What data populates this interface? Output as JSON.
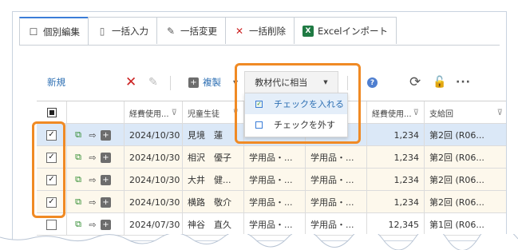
{
  "tabs": [
    {
      "label": "個別編集",
      "icon": "edit-list-icon",
      "active": true
    },
    {
      "label": "一括入力",
      "icon": "document-icon",
      "active": false
    },
    {
      "label": "一括変更",
      "icon": "pencil-icon",
      "active": false
    },
    {
      "label": "一括削除",
      "icon": "close-icon",
      "active": false
    },
    {
      "label": "Excelインポート",
      "icon": "excel-icon",
      "active": false
    }
  ],
  "tab_glyphs": {
    "edit": "☐",
    "doc": "▯",
    "pencil": "✎",
    "close": "✕",
    "excel": "X"
  },
  "toolbar": {
    "new_label": "新規",
    "delete_glyph": "✕",
    "edit_glyph": "✎",
    "duplicate_label": "複製",
    "duplicate_glyph": "+",
    "caret": "▼",
    "material_label": "教材代に相当",
    "help_glyph": "?",
    "refresh_glyph": "⟳",
    "unlock_glyph": "🔓",
    "more_glyph": "···"
  },
  "menu": {
    "items": [
      {
        "label": "チェックを入れる",
        "checked": true
      },
      {
        "label": "チェックを外す",
        "checked": false
      }
    ]
  },
  "grid": {
    "columns": {
      "date": "経費使用...",
      "student": "児童生徒",
      "amount": "経費使用...",
      "payment": "支給回"
    },
    "filter_glyph": "⊽",
    "rows": [
      {
        "checked": true,
        "date": "2024/10/30",
        "student": "見境　蓮",
        "a": "",
        "b": "",
        "amount": "1,234",
        "payment": "第2回 (R06..."
      },
      {
        "checked": true,
        "date": "2024/10/30",
        "student": "相沢　優子",
        "a": "学用品・...",
        "b": "学用品・...",
        "amount": "1,234",
        "payment": "第2回 (R06..."
      },
      {
        "checked": true,
        "date": "2024/10/30",
        "student": "大井　健...",
        "a": "学用品・...",
        "b": "学用品・...",
        "amount": "1,234",
        "payment": "第2回 (R06..."
      },
      {
        "checked": true,
        "date": "2024/10/30",
        "student": "横路　敬介",
        "a": "学用品・...",
        "b": "学用品・...",
        "amount": "1,234",
        "payment": "第2回 (R06..."
      },
      {
        "checked": false,
        "date": "2024/07/30",
        "student": "神谷　直久",
        "a": "学用品・...",
        "b": "学用品・...",
        "amount": "12,345",
        "payment": "第1回 (R06..."
      }
    ],
    "row_icons": {
      "check": "✓",
      "new": "⧉",
      "edit": "⇨",
      "add": "+"
    }
  },
  "colors": {
    "accent": "#2d6fb3",
    "highlight": "#f08a24",
    "selected_row": "#dbe8f7"
  }
}
